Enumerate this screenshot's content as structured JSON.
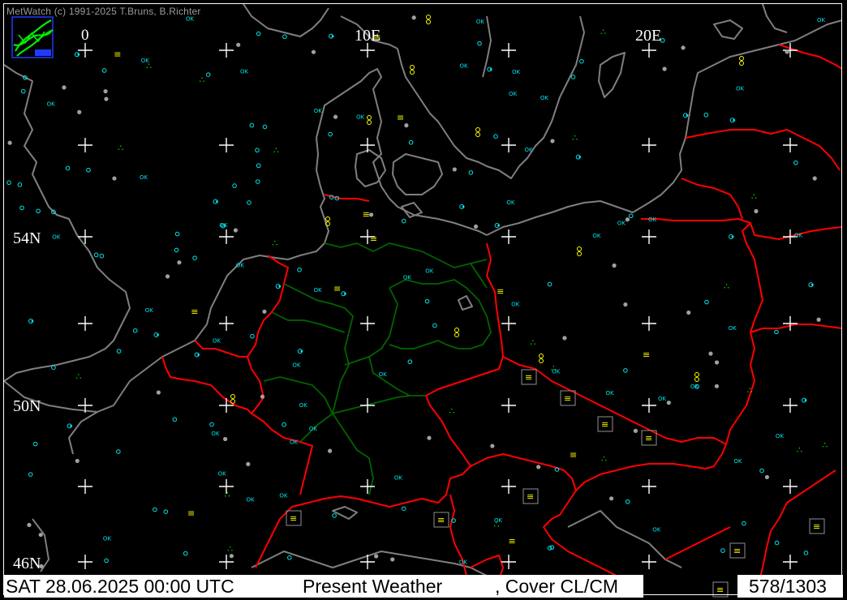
{
  "header": {
    "copyright": "MetWatch  (c) 1991-2025 T.Bruns, B.Richter"
  },
  "axes": {
    "lon_labels": [
      "0",
      "10E",
      "20E"
    ],
    "lat_labels": [
      "54N",
      "50N",
      "46N"
    ]
  },
  "status": {
    "datetime": "SAT 28.06.2025 00:00 UTC",
    "product": "Present Weather",
    "layer": ", Cover CL/CM",
    "station_count": "578/1303"
  },
  "colors": {
    "background": "#000000",
    "coastline": "#7f7f7f",
    "country_border": "#ff0000",
    "state_border": "#006400",
    "grid_cross": "#ffffff",
    "ok_marker": "#00e5ee",
    "cover_marker": "#a0a0a0",
    "precip_marker": "#00ee00",
    "fog_marker": "#ffff00"
  },
  "legend": {
    "ok_text": "OK",
    "logo_icon": "metwatch-logo-icon"
  }
}
